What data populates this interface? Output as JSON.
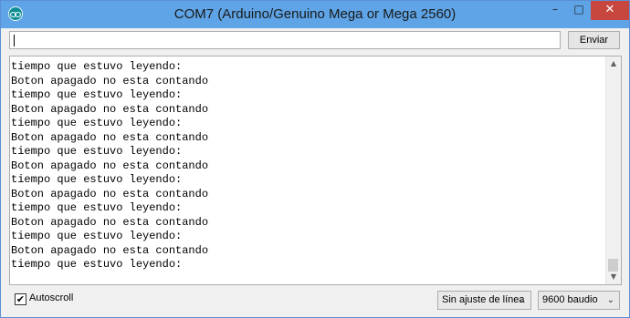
{
  "window": {
    "title": "COM7 (Arduino/Genuino Mega or Mega 2560)",
    "controls": {
      "minimize": "–",
      "maximize": "□",
      "close": "✕"
    }
  },
  "input": {
    "value": "",
    "send_label": "Enviar"
  },
  "output": {
    "lines": [
      "tiempo que estuvo leyendo:",
      "Boton apagado no esta contando",
      "tiempo que estuvo leyendo:",
      "Boton apagado no esta contando",
      "tiempo que estuvo leyendo:",
      "Boton apagado no esta contando",
      "tiempo que estuvo leyendo:",
      "Boton apagado no esta contando",
      "tiempo que estuvo leyendo:",
      "Boton apagado no esta contando",
      "tiempo que estuvo leyendo:",
      "Boton apagado no esta contando",
      "tiempo que estuvo leyendo:",
      "Boton apagado no esta contando",
      "tiempo que estuvo leyendo:"
    ]
  },
  "footer": {
    "autoscroll_label": "Autoscroll",
    "autoscroll_checked": true,
    "line_ending": "Sin ajuste de línea",
    "baud_rate": "9600 baudio"
  },
  "icons": {
    "app": "arduino-icon",
    "dropdown": "chevron-down-icon",
    "check": "checkmark-icon"
  },
  "colors": {
    "titlebar": "#5ea4e6",
    "close_button": "#c7463e",
    "app_icon": "#0f8d95"
  }
}
